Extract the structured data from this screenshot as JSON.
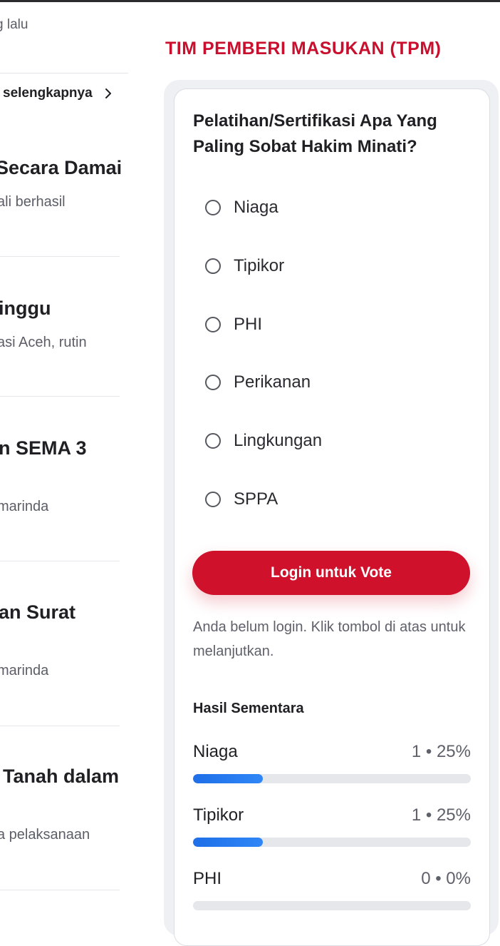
{
  "left": {
    "time_ago": "g lalu",
    "more_label": "selengkapnya",
    "news": [
      {
        "title": "Secara Damai",
        "sub": "ali berhasil"
      },
      {
        "title": "inggu",
        "sub": "asi Aceh, rutin"
      },
      {
        "title": "n SEMA 3",
        "sub": "marinda"
      },
      {
        "title": "an Surat",
        "sub": "marinda"
      },
      {
        "title": "Tanah dalam",
        "sub": "a pelaksanaan"
      }
    ]
  },
  "poll": {
    "section_title": "TIM PEMBERI MASUKAN (TPM)",
    "question": "Pelatihan/Sertifikasi Apa Yang Paling Sobat Hakim Minati?",
    "options": [
      "Niaga",
      "Tipikor",
      "PHI",
      "Perikanan",
      "Lingkungan",
      "SPPA"
    ],
    "vote_button": "Login untuk Vote",
    "login_note": "Anda belum login. Klik tombol di atas untuk melanjutkan.",
    "results_title": "Hasil Sementara",
    "results": [
      {
        "name": "Niaga",
        "stat": "1 • 25%",
        "percent": 25
      },
      {
        "name": "Tipikor",
        "stat": "1 • 25%",
        "percent": 25
      },
      {
        "name": "PHI",
        "stat": "0 • 0%",
        "percent": 0
      }
    ],
    "colors": {
      "accent": "#c8102e",
      "button": "#d0112b",
      "bar": "#1f6fe8"
    }
  }
}
